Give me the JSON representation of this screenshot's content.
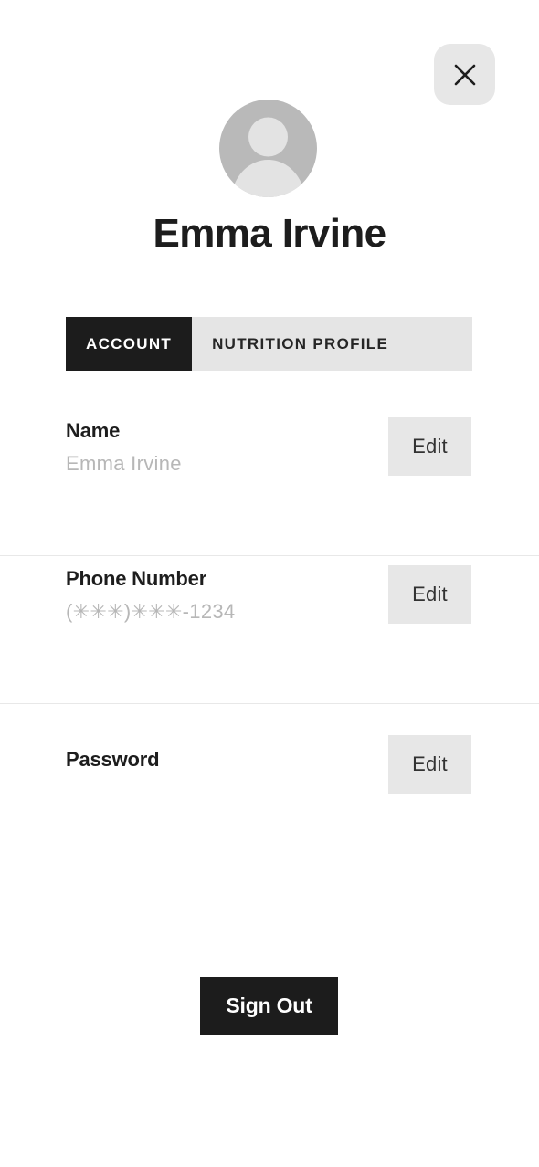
{
  "header": {
    "close_icon": "close-icon",
    "avatar_icon": "person-avatar-icon",
    "profile_name": "Emma Irvine"
  },
  "tabs": [
    {
      "label": "ACCOUNT",
      "active": true
    },
    {
      "label": "NUTRITION PROFILE",
      "active": false
    }
  ],
  "rows": [
    {
      "label": "Name",
      "value": "Emma Irvine",
      "action_label": "Edit"
    },
    {
      "label": "Phone Number",
      "value": "(✳✳✳)✳✳✳-1234",
      "action_label": "Edit"
    },
    {
      "label": "Password",
      "value": "",
      "action_label": "Edit"
    }
  ],
  "footer": {
    "sign_out_label": "Sign Out"
  },
  "colors": {
    "accent_dark": "#1c1c1c",
    "button_gray": "#e7e7e7",
    "tab_inactive_bg": "#e5e5e5",
    "value_text": "#b7b7b7",
    "divider": "#e8e8e8",
    "avatar_bg": "#b9b9b9",
    "avatar_fg": "#e3e3e3",
    "page_bg": "#ffffff"
  }
}
